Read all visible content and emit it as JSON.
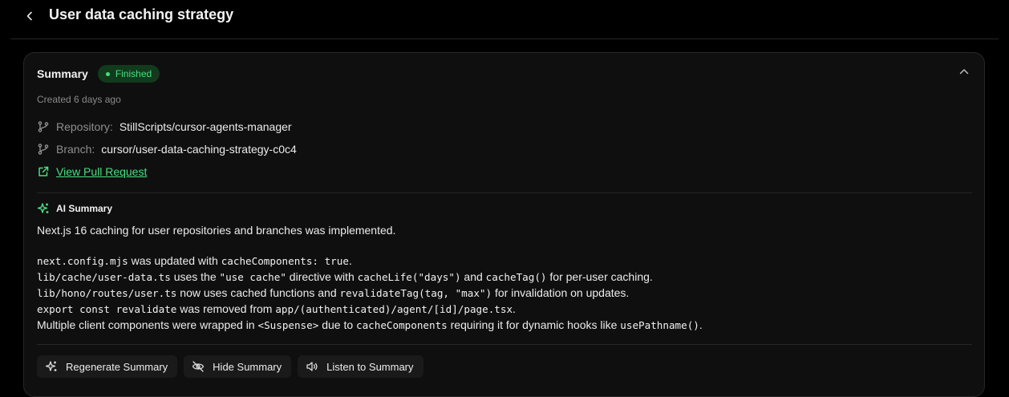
{
  "header": {
    "back_icon": "chevron-left-icon",
    "title": "User data caching strategy"
  },
  "summary": {
    "title": "Summary",
    "status": "Finished",
    "status_color": "#4ade80",
    "collapse_icon": "chevron-up-icon",
    "created": "Created 6 days ago",
    "repository": {
      "icon": "git-branch-icon",
      "label": "Repository:",
      "value": "StillScripts/cursor-agents-manager"
    },
    "branch": {
      "icon": "git-branch-icon",
      "label": "Branch:",
      "value": "cursor/user-data-caching-strategy-c0c4"
    },
    "pull_request": {
      "icon": "external-link-icon",
      "label": "View Pull Request"
    }
  },
  "ai_summary": {
    "icon": "sparkles-icon",
    "title": "AI Summary",
    "intro": "Next.js 16 caching for user repositories and branches was implemented.",
    "lines": [
      [
        {
          "code": "next.config.mjs"
        },
        {
          "text": " was updated with "
        },
        {
          "code": "cacheComponents: true"
        },
        {
          "text": "."
        }
      ],
      [
        {
          "code": "lib/cache/user-data.ts"
        },
        {
          "text": " uses the "
        },
        {
          "code": "\"use cache\""
        },
        {
          "text": " directive with "
        },
        {
          "code": "cacheLife(\"days\")"
        },
        {
          "text": " and "
        },
        {
          "code": "cacheTag()"
        },
        {
          "text": " for per-user caching."
        }
      ],
      [
        {
          "code": "lib/hono/routes/user.ts"
        },
        {
          "text": " now uses cached functions and "
        },
        {
          "code": "revalidateTag(tag, \"max\")"
        },
        {
          "text": " for invalidation on updates."
        }
      ],
      [
        {
          "code": "export const revalidate"
        },
        {
          "text": " was removed from "
        },
        {
          "code": "app/(authenticated)/agent/[id]/page.tsx"
        },
        {
          "text": "."
        }
      ],
      [
        {
          "text": "Multiple client components were wrapped in "
        },
        {
          "code": "<Suspense>"
        },
        {
          "text": " due to "
        },
        {
          "code": "cacheComponents"
        },
        {
          "text": " requiring it for dynamic hooks like "
        },
        {
          "code": "usePathname()"
        },
        {
          "text": "."
        }
      ]
    ]
  },
  "actions": [
    {
      "icon": "sparkles-icon",
      "label": "Regenerate Summary"
    },
    {
      "icon": "eye-off-icon",
      "label": "Hide Summary"
    },
    {
      "icon": "speaker-icon",
      "label": "Listen to Summary"
    }
  ]
}
